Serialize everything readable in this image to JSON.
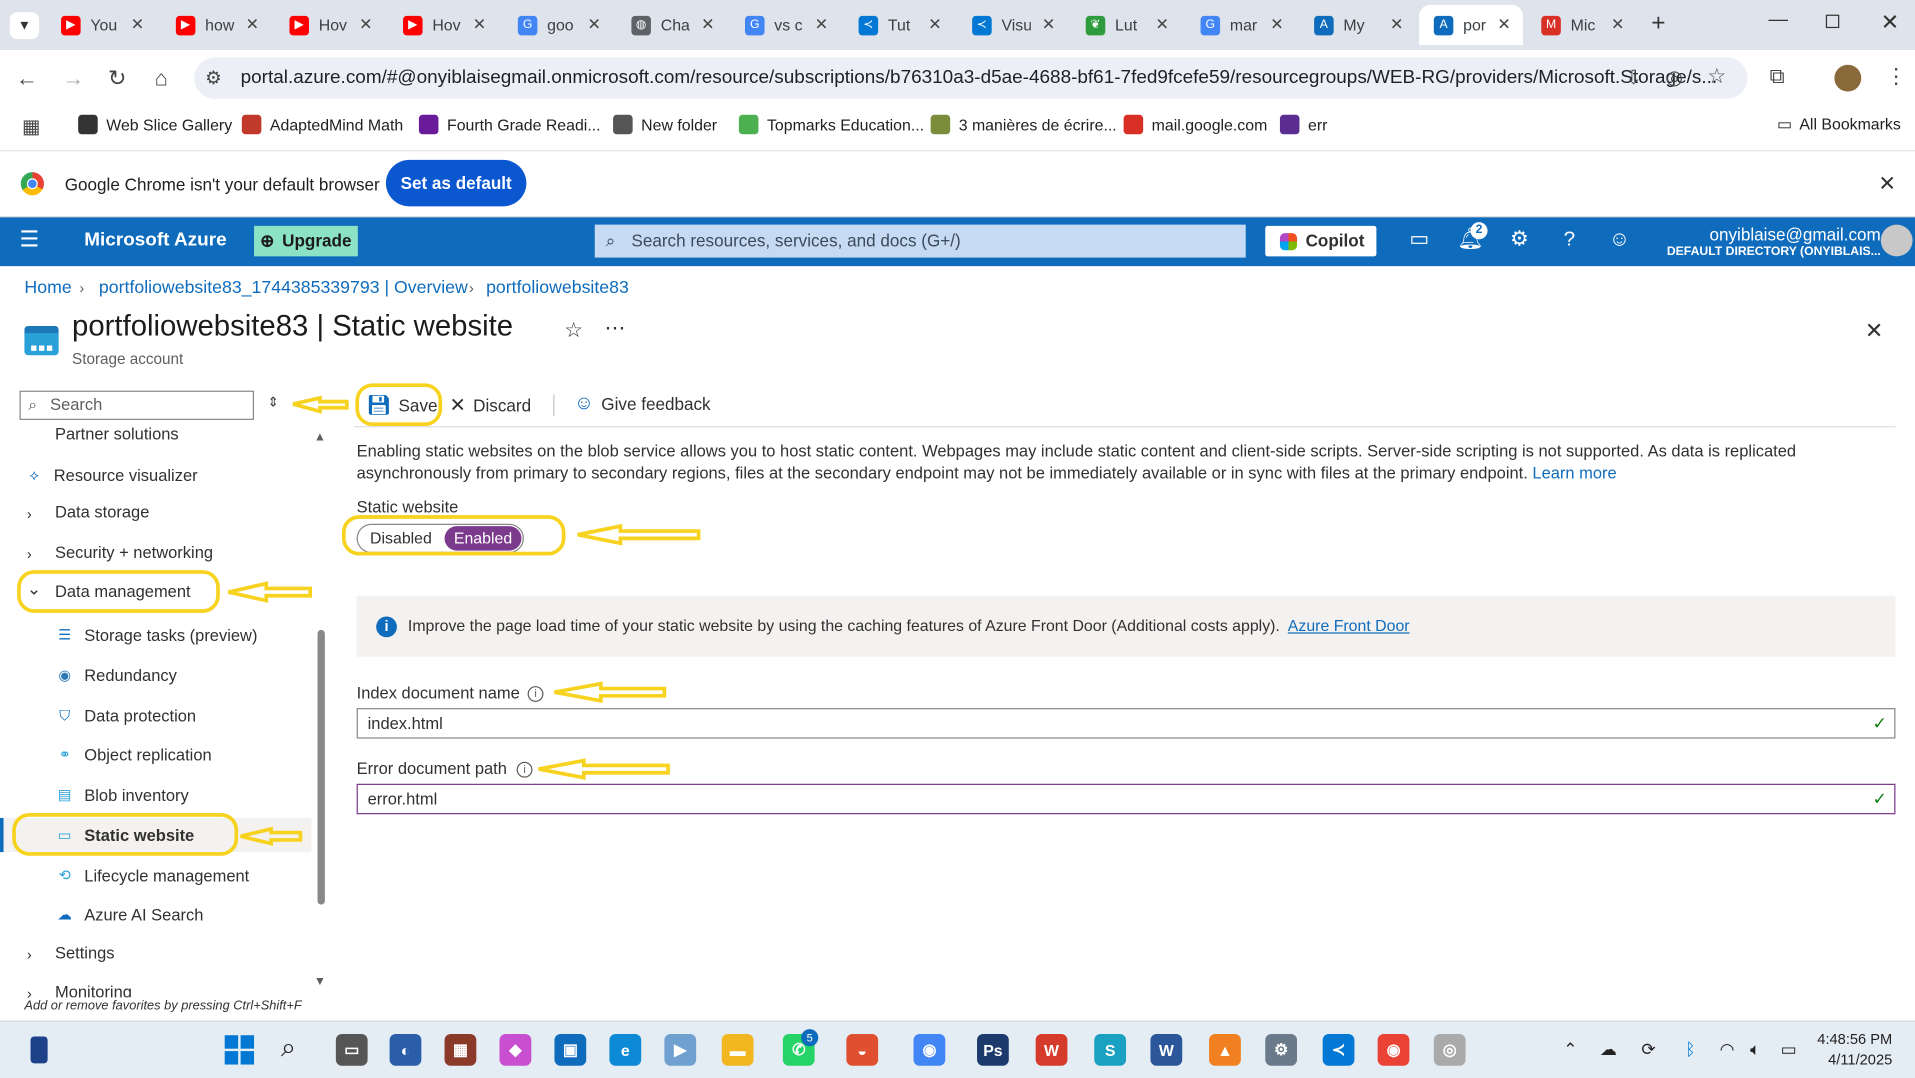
{
  "browser": {
    "tabs": [
      {
        "label": "You",
        "favicon": "youtube-icon",
        "color": "#ff0000"
      },
      {
        "label": "how",
        "favicon": "youtube-icon",
        "color": "#ff0000"
      },
      {
        "label": "Hov",
        "favicon": "youtube-icon",
        "color": "#ff0000"
      },
      {
        "label": "Hov",
        "favicon": "youtube-icon",
        "color": "#ff0000"
      },
      {
        "label": "goo",
        "favicon": "google-icon",
        "color": "#4285f4"
      },
      {
        "label": "Cha",
        "favicon": "globe-icon",
        "color": "#5f6368"
      },
      {
        "label": "vs c",
        "favicon": "google-icon",
        "color": "#4285f4"
      },
      {
        "label": "Tut",
        "favicon": "vscode-icon",
        "color": "#0078d4"
      },
      {
        "label": "Visu",
        "favicon": "vscode-icon",
        "color": "#0078d4"
      },
      {
        "label": "Lut",
        "favicon": "leaf-icon",
        "color": "#2e9b3e"
      },
      {
        "label": "mar",
        "favicon": "google-icon",
        "color": "#4285f4"
      },
      {
        "label": "My",
        "favicon": "azure-icon",
        "color": "#0f6cbd"
      },
      {
        "label": "por",
        "favicon": "azure-icon",
        "color": "#0f6cbd"
      },
      {
        "label": "Mic",
        "favicon": "gmail-icon",
        "color": "#d93025"
      }
    ],
    "url": "portal.azure.com/#@onyiblaisegmail.onmicrosoft.com/resource/subscriptions/b76310a3-d5ae-4688-bf61-7fed9fcefe59/resourcegroups/WEB-RG/providers/Microsoft.Storage/s...",
    "bookmarks": [
      {
        "label": "Web Slice Gallery",
        "color": "#333"
      },
      {
        "label": "AdaptedMind Math",
        "color": "#c0392b"
      },
      {
        "label": "Fourth Grade Readi...",
        "color": "#6a1b9a"
      },
      {
        "label": "New folder",
        "color": "#555"
      },
      {
        "label": "Topmarks Education...",
        "color": "#4caf50"
      },
      {
        "label": "3 manières de écrire...",
        "color": "#7b8c3a"
      },
      {
        "label": "mail.google.com",
        "color": "#d93025"
      },
      {
        "label": "err",
        "color": "#5c2d91"
      }
    ],
    "all_bookmarks": "All Bookmarks",
    "infobar_text": "Google Chrome isn't your default browser",
    "set_default": "Set as default"
  },
  "azure": {
    "brand": "Microsoft Azure",
    "upgrade": "Upgrade",
    "search_placeholder": "Search resources, services, and docs (G+/)",
    "copilot": "Copilot",
    "notification_count": "2",
    "user_email": "onyiblaise@gmail.com",
    "user_directory": "DEFAULT DIRECTORY (ONYIBLAIS..."
  },
  "breadcrumb": [
    "Home",
    "portfoliowebsite83_1744385339793 | Overview",
    "portfoliowebsite83"
  ],
  "page": {
    "title": "portfoliowebsite83 | Static website",
    "subtitle": "Storage account"
  },
  "sidebar": {
    "search_placeholder": "Search",
    "items": [
      {
        "label": "Partner solutions"
      },
      {
        "label": "Resource visualizer"
      },
      {
        "label": "Data storage"
      },
      {
        "label": "Security + networking"
      },
      {
        "label": "Data management"
      },
      {
        "label": "Storage tasks (preview)"
      },
      {
        "label": "Redundancy"
      },
      {
        "label": "Data protection"
      },
      {
        "label": "Object replication"
      },
      {
        "label": "Blob inventory"
      },
      {
        "label": "Static website"
      },
      {
        "label": "Lifecycle management"
      },
      {
        "label": "Azure AI Search"
      },
      {
        "label": "Settings"
      },
      {
        "label": "Monitoring"
      }
    ],
    "footer_hint": "Add or remove favorites by pressing Ctrl+Shift+F"
  },
  "toolbar": {
    "save": "Save",
    "discard": "Discard",
    "feedback": "Give feedback"
  },
  "content": {
    "description": "Enabling static websites on the blob service allows you to host static content. Webpages may include static content and client-side scripts. Server-side scripting is not supported. As data is replicated asynchronously from primary to secondary regions, files at the secondary endpoint may not be immediately available or in sync with files at the primary endpoint.",
    "learn_more": "Learn more",
    "static_website_label": "Static website",
    "toggle_disabled": "Disabled",
    "toggle_enabled": "Enabled",
    "toggle_state": "Enabled",
    "info_text": "Improve the page load time of your static website by using the caching features of Azure Front Door (Additional costs apply).",
    "info_link": "Azure Front Door",
    "index_label": "Index document name",
    "index_value": "index.html",
    "error_label": "Error document path",
    "error_value": "error.html"
  },
  "taskbar": {
    "whatsapp_badge": "5",
    "time": "4:48:56 PM",
    "date": "4/11/2025"
  },
  "colors": {
    "azure_blue": "#0f6cbd",
    "toggle_purple": "#7c3a8c",
    "annotation_yellow": "#f7d21e"
  }
}
